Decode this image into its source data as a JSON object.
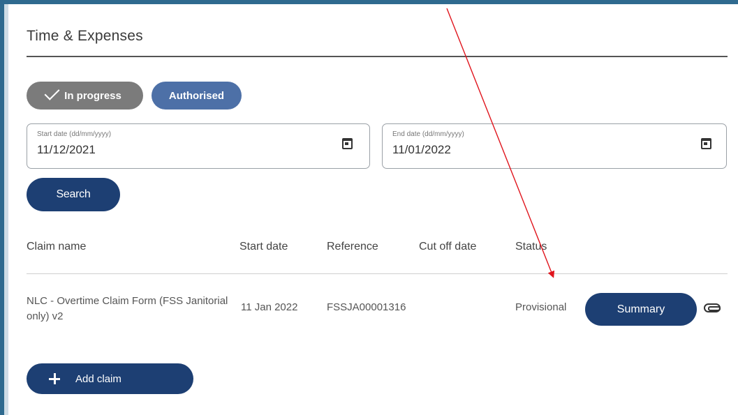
{
  "page": {
    "title": "Time & Expenses"
  },
  "filters": {
    "chips": [
      {
        "label": "In progress",
        "selected": true
      },
      {
        "label": "Authorised",
        "selected": false
      }
    ]
  },
  "dates": {
    "start": {
      "label": "Start date (dd/mm/yyyy)",
      "value": "11/12/2021"
    },
    "end": {
      "label": "End date (dd/mm/yyyy)",
      "value": "11/01/2022"
    }
  },
  "search_label": "Search",
  "table": {
    "columns": [
      "Claim name",
      "Start date",
      "Reference",
      "Cut off date",
      "Status"
    ],
    "rows": [
      {
        "claim_name": "NLC - Overtime Claim Form (FSS Janitorial only) v2",
        "start_date": "11 Jan 2022",
        "reference": "FSSJA00001316",
        "cut_off_date": "",
        "status": "Provisional",
        "action_label": "Summary"
      }
    ]
  },
  "add_claim_label": "Add claim",
  "colors": {
    "primary_button": "#1d3f73",
    "chip_in_progress": "#7b7b7b",
    "chip_authorised": "#4d70a7",
    "annotation_arrow": "#e0151d"
  },
  "icons": [
    "check-icon",
    "calendar-icon",
    "paperclip-icon",
    "plus-icon"
  ]
}
